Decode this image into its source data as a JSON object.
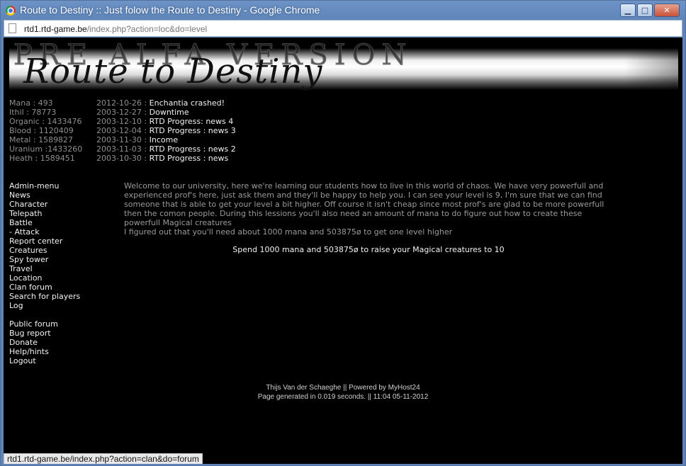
{
  "window": {
    "title": "Route to Destiny :: Just folow the Route to Destiny - Google Chrome",
    "buttons": {
      "minimize": "▁",
      "maximize": "□",
      "close": "✕"
    }
  },
  "address": {
    "host": "rtd1.rtd-game.be",
    "path": "/index.php?action=loc&do=level"
  },
  "banner": {
    "watermark": "PRE ALFA VERSION",
    "logo": "Route to Destiny"
  },
  "resources": [
    {
      "text": "Mana : 493"
    },
    {
      "text": "Ithil : 78773"
    },
    {
      "text": "Organic : 1433476"
    },
    {
      "text": "Blood : 1120409"
    },
    {
      "text": "Metal : 1589827"
    },
    {
      "text": "Uranium :1433260"
    },
    {
      "text": "Heath : 1589451"
    }
  ],
  "news": [
    {
      "date": "2012-10-26 : ",
      "title": "Enchantia crashed!"
    },
    {
      "date": "2003-12-27 : ",
      "title": "Downtime"
    },
    {
      "date": "2003-12-10 : ",
      "title": "RTD Progress: news 4"
    },
    {
      "date": "2003-12-04 : ",
      "title": "RTD Progress : news 3"
    },
    {
      "date": "2003-11-30 : ",
      "title": "Income"
    },
    {
      "date": "2003-11-03 : ",
      "title": "RTD Progress : news 2"
    },
    {
      "date": "2003-10-30 : ",
      "title": "RTD Progress : news"
    }
  ],
  "menu": {
    "main": [
      "Admin-menu",
      "News",
      "Character",
      "Telepath",
      "Battle",
      "- Attack",
      "Report center",
      "Creatures",
      "Spy tower",
      "Travel",
      "Location",
      "Clan forum",
      "Search for players",
      "Log"
    ],
    "secondary": [
      "Public forum",
      "Bug report",
      "Donate",
      "Help/hints",
      "Logout"
    ]
  },
  "main": {
    "intro": "Welcome to our university, here we're learning our students how to live in this world of chaos. We have very powerfull and experienced prof's here, just ask them and they'll be happy to help you. I can see your level is 9, I'm sure that we can find someone that is able to get your level a bit higher. Off course it isn't cheap since most prof's are glad to be more powerfull then the comon people. During this lessions you'll also need an amount of mana to do figure out how to create these powerfull Magical creatures",
    "requirement": "I figured out that you'll need about 1000 mana and 503875ø to get one level higher",
    "action": "Spend 1000 mana and 503875ø to raise your Magical creatures to 10"
  },
  "footer": {
    "line1": "Thijs Van der Schaeghe || Powered by MyHost24",
    "line2": "Page generated in 0.019 seconds. || 11:04 05-11-2012"
  },
  "status": {
    "url": "rtd1.rtd-game.be/index.php?action=clan&do=forum"
  }
}
